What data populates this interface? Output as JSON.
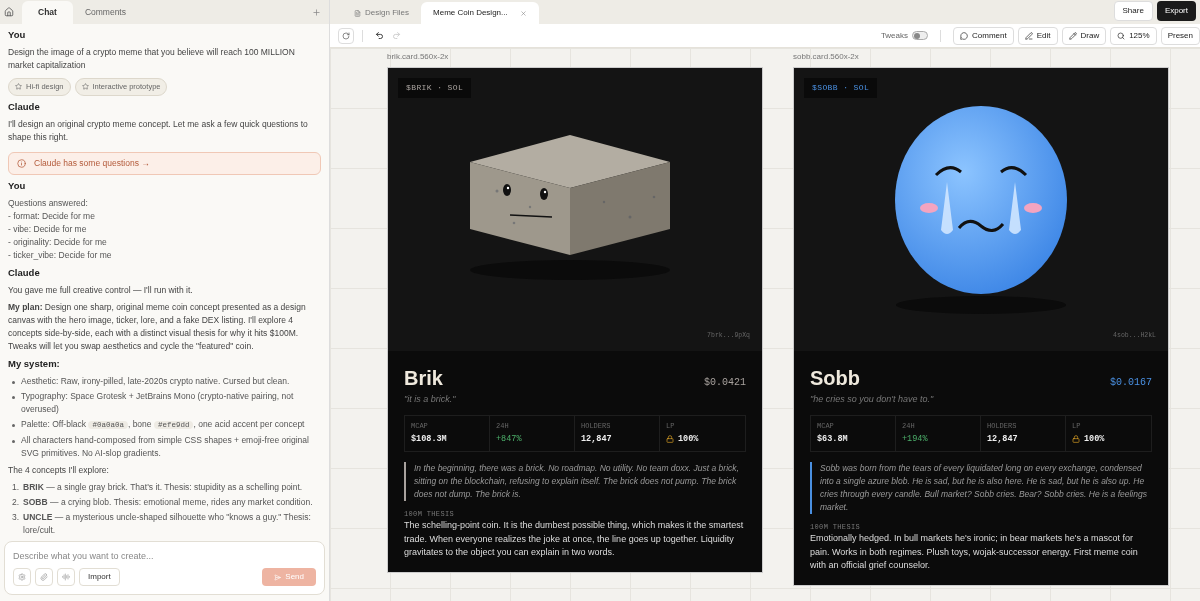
{
  "chat_panel": {
    "tabs": [
      {
        "label": "Chat",
        "selected": true
      },
      {
        "label": "Comments",
        "selected": false
      }
    ],
    "messages": [
      {
        "kind": "author",
        "text": "You"
      },
      {
        "kind": "paragraph",
        "text": "Design the image of a crypto meme that you believe will reach 100 MILLION market capitalization"
      },
      {
        "kind": "chips",
        "items": [
          "Hi-fi design",
          "Interactive prototype"
        ]
      },
      {
        "kind": "author",
        "text": "Claude"
      },
      {
        "kind": "paragraph",
        "text": "I'll design an original crypto meme concept. Let me ask a few quick questions to shape this right."
      },
      {
        "kind": "notice",
        "text": "Claude has some questions →"
      },
      {
        "kind": "author",
        "text": "You"
      },
      {
        "kind": "lines",
        "items": [
          "Questions answered:",
          "- format: Decide for me",
          "- vibe: Decide for me",
          "- originality: Decide for me",
          "- ticker_vibe: Decide for me"
        ]
      },
      {
        "kind": "author",
        "text": "Claude"
      },
      {
        "kind": "paragraph",
        "text": "You gave me full creative control — I'll run with it."
      },
      {
        "kind": "paragraph",
        "text": "**My plan:** Design one sharp, original meme coin concept presented as a design canvas with the hero image, ticker, lore, and a fake DEX listing. I'll explore 4 concepts side-by-side, each with a distinct visual thesis for why it hits $100M. Tweaks will let you swap aesthetics and cycle the \"featured\" coin."
      },
      {
        "kind": "heading",
        "text": "My system:"
      },
      {
        "kind": "bullets",
        "items": [
          [
            {
              "kind": "text",
              "text": "Aesthetic: Raw, irony-pilled, late-2020s crypto native. Cursed but clean."
            }
          ],
          [
            {
              "kind": "text",
              "text": "Typography: Space Grotesk + JetBrains Mono (crypto-native pairing, not overused)"
            }
          ],
          [
            {
              "kind": "text",
              "text": "Palette: Off-black "
            },
            {
              "kind": "code",
              "text": "#0a0a0a"
            },
            {
              "kind": "text",
              "text": ", bone "
            },
            {
              "kind": "code",
              "text": "#efe9dd"
            },
            {
              "kind": "text",
              "text": ", one acid accent per concept"
            }
          ],
          [
            {
              "kind": "text",
              "text": "All characters hand-composed from simple CSS shapes + emoji-free original SVG primitives. No AI-slop gradients."
            }
          ]
        ]
      },
      {
        "kind": "paragraph",
        "text": "The 4 concepts I'll explore:"
      },
      {
        "kind": "numbered",
        "items": [
          {
            "number": "1.",
            "text": "**BRIK** — a single gray brick. That's it. Thesis: stupidity as a schelling point."
          },
          {
            "number": "2.",
            "text": "**SOBB** — a crying blob. Thesis: emotional meme, rides any market condition."
          },
          {
            "number": "3.",
            "text": "**UNCLE** — a mysterious uncle-shaped silhouette who \"knows a guy.\" Thesis: lore/cult."
          }
        ]
      }
    ],
    "composer": {
      "placeholder": "Describe what you want to create...",
      "import_label": "Import",
      "send": {
        "label": "Send",
        "disabled": true
      }
    }
  },
  "canvas_panel": {
    "tabs": [
      {
        "label": "Design Files",
        "selected": false,
        "closable": false
      },
      {
        "label": "Meme Coin Design...",
        "selected": true,
        "closable": true
      }
    ],
    "header_buttons": [
      {
        "label": "Share",
        "primary": false
      },
      {
        "label": "Export",
        "primary": true
      }
    ],
    "history": [
      {
        "kind": "undo",
        "disabled": false
      },
      {
        "kind": "redo",
        "disabled": true
      }
    ],
    "tweaks": {
      "label": "Tweaks",
      "on": false
    },
    "tools": [
      {
        "kind": "comment",
        "label": "Comment"
      },
      {
        "kind": "edit",
        "label": "Edit"
      },
      {
        "kind": "draw",
        "label": "Draw"
      },
      {
        "kind": "zoom",
        "label": "125%"
      },
      {
        "kind": "present",
        "label": "Presen"
      }
    ],
    "cards": [
      {
        "kind": "brick",
        "frame_label": "brik.card.560x-2x",
        "ticker": "$BRIK · SOL",
        "address": "7brk...9pXq",
        "name": "Brik",
        "price": "$0.0421",
        "color": "#a8a29e",
        "tagline": "\"it is a brick.\"",
        "stats": [
          {
            "kind": "plain",
            "label": "MCAP",
            "value": "$108.3M"
          },
          {
            "kind": "change",
            "label": "24H",
            "value": "+847%"
          },
          {
            "kind": "plain",
            "label": "HOLDERS",
            "value": "12,847"
          },
          {
            "kind": "locked",
            "label": "LP",
            "value": "100%"
          }
        ],
        "lore": "In the beginning, there was a brick. No roadmap. No utility. No team doxx. Just a brick, sitting on the blockchain, refusing to explain itself. The brick does not pump. The brick does not dump. The brick is.",
        "thesis_label": "100M THESIS",
        "thesis": "The schelling-point coin. It is the dumbest possible thing, which makes it the smartest trade. When everyone realizes the joke at once, the line goes up together. Liquidity gravitates to the object you can explain in two words."
      },
      {
        "kind": "blob",
        "frame_label": "sobb.card.560x-2x",
        "ticker": "$SOBB · SOL",
        "address": "4sob...H2kL",
        "name": "Sobb",
        "price": "$0.0167",
        "color": "#4a90e2",
        "tagline": "\"he cries so you don't have to.\"",
        "stats": [
          {
            "kind": "plain",
            "label": "MCAP",
            "value": "$63.8M"
          },
          {
            "kind": "change",
            "label": "24H",
            "value": "+194%"
          },
          {
            "kind": "plain",
            "label": "HOLDERS",
            "value": "12,847"
          },
          {
            "kind": "locked",
            "label": "LP",
            "value": "100%"
          }
        ],
        "lore": "Sobb was born from the tears of every liquidated long on every exchange, condensed into a single azure blob. He is sad, but he is also here. He is sad, but he is also up. He cries through every candle. Bull market? Sobb cries. Bear? Sobb cries. He is a feelings market.",
        "thesis_label": "100M THESIS",
        "thesis": "Emotionally hedged. In bull markets he's ironic; in bear markets he's a mascot for pain. Works in both regimes. Plush toys, wojak-successor energy. First meme coin with an official grief counselor."
      }
    ]
  }
}
